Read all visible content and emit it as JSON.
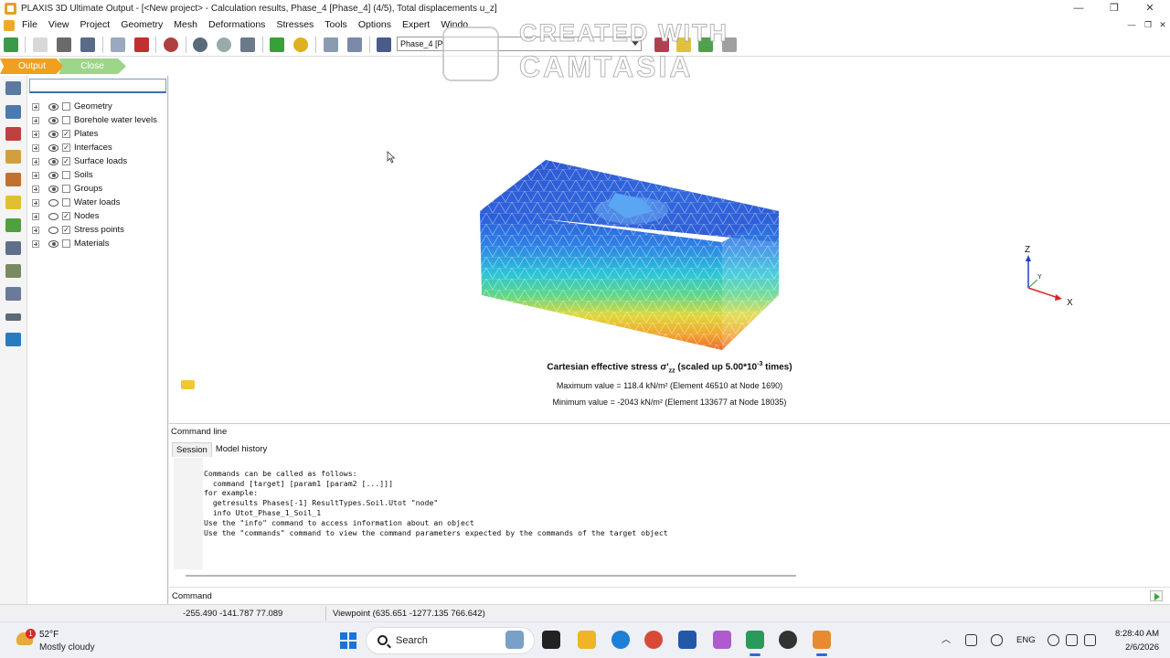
{
  "window": {
    "title": "PLAXIS 3D Ultimate Output - [<New project> - Calculation results, Phase_4 [Phase_4] (4/5), Total displacements u_z]",
    "minimize": "—",
    "restore": "❐",
    "close": "✕"
  },
  "menu": {
    "items": [
      "File",
      "View",
      "Project",
      "Geometry",
      "Mesh",
      "Deformations",
      "Stresses",
      "Tools",
      "Options",
      "Expert",
      "Windo"
    ]
  },
  "toolbar": {
    "phase_value": "Phase_4 [P"
  },
  "tabs": {
    "output": "Output",
    "close": "Close",
    "output_color": "#f0a020",
    "close_color": "#9dd58a"
  },
  "tree": {
    "search_value": "",
    "items": [
      {
        "label": "Geometry",
        "visible": true,
        "checked": false
      },
      {
        "label": "Borehole water levels",
        "visible": true,
        "checked": false
      },
      {
        "label": "Plates",
        "visible": true,
        "checked": true
      },
      {
        "label": "Interfaces",
        "visible": true,
        "checked": true
      },
      {
        "label": "Surface loads",
        "visible": true,
        "checked": true
      },
      {
        "label": "Soils",
        "visible": true,
        "checked": false
      },
      {
        "label": "Groups",
        "visible": true,
        "checked": false
      },
      {
        "label": "Water loads",
        "visible": false,
        "checked": false
      },
      {
        "label": "Nodes",
        "visible": false,
        "checked": true
      },
      {
        "label": "Stress points",
        "visible": false,
        "checked": true
      },
      {
        "label": "Materials",
        "visible": true,
        "checked": false
      }
    ]
  },
  "viewport": {
    "axis_z": "Z",
    "axis_y": "Y",
    "axis_x": "X",
    "legend_title_prefix": "Cartesian effective stress σ'",
    "legend_title_sub": "zz",
    "legend_title_suffix": " (scaled up 5.00*10",
    "legend_title_exp": "-3",
    "legend_title_end": " times)",
    "max_value": "Maximum value = 118.4 kN/m² (Element 46510 at Node 1690)",
    "min_value": "Minimum value = -2043 kN/m² (Element 133677 at Node 18035)"
  },
  "command_panel": {
    "title": "Command line",
    "tabs": [
      "Session",
      "Model history"
    ],
    "output_lines": [
      "Commands can be called as follows:",
      "  command [target] [param1 [param2 [...]]]",
      "for example:",
      "  getresults Phases[-1] ResultTypes.Soil.Utot \"node\"",
      "  info Utot_Phase_1_Soil_1",
      "Use the \"info\" command to access information about an object",
      "Use the \"commands\" command to view the command parameters expected by the commands of the target object"
    ],
    "input_label": "Command",
    "input_value": ""
  },
  "status": {
    "coords": "-255.490 -141.787 77.089",
    "viewpoint": "Viewpoint (635.651 -1277.135 766.642)"
  },
  "taskbar": {
    "weather_temp": "52°F",
    "weather_cond": "Mostly cloudy",
    "weather_badge": "1",
    "search_label": "Search",
    "language": "ENG",
    "time": "8:28:40 AM",
    "date": "2/6/2026"
  },
  "watermark": {
    "line1": "CREATED WITH",
    "line2": "CAMTASIA"
  }
}
